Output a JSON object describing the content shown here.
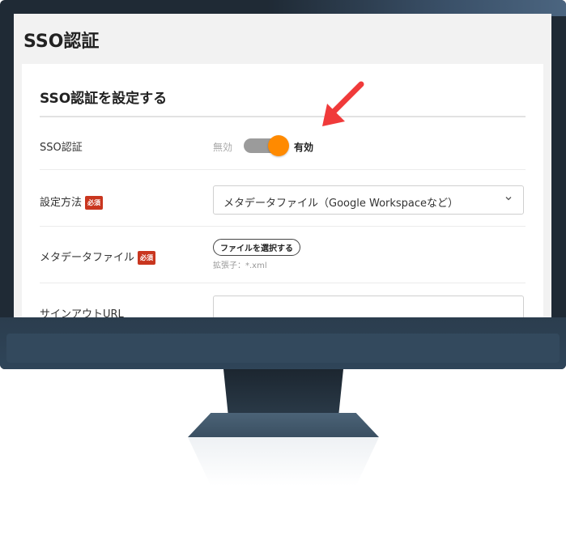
{
  "screen": {
    "title": "SSO認証"
  },
  "card": {
    "title": "SSO認証を設定する"
  },
  "rows": {
    "sso": {
      "label": "SSO認証",
      "toggle_off_label": "無効",
      "toggle_on_label": "有効",
      "toggle_state": "on"
    },
    "method": {
      "label": "設定方法",
      "required_badge": "必須",
      "selected_value": "メタデータファイル（Google Workspaceなど）"
    },
    "metadata": {
      "label": "メタデータファイル",
      "required_badge": "必須",
      "file_button_label": "ファイルを選択する",
      "hint": "拡張子：*.xml"
    },
    "signout": {
      "label": "サインアウトURL",
      "value": ""
    }
  },
  "colors": {
    "toggle_knob": "#ff8a00",
    "required_badge": "#c9361f",
    "arrow": "#f03a3a",
    "monitor_frame": "#1f2a35"
  }
}
